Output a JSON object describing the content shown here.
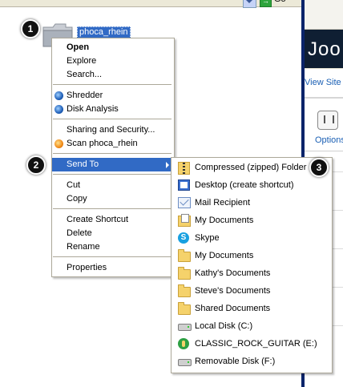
{
  "top_toolbar": {
    "go_label": "Go"
  },
  "right_panel": {
    "logo_text": "Joo",
    "view_site": "View Site",
    "options_label": "Options"
  },
  "folder": {
    "name": "phoca_rhein"
  },
  "callouts": {
    "one": "1",
    "two": "2",
    "three": "3"
  },
  "context_menu": {
    "items": [
      {
        "label": "Open",
        "bold": true
      },
      {
        "label": "Explore"
      },
      {
        "label": "Search..."
      },
      {
        "label": "Shredder",
        "icon": "shredder-icon"
      },
      {
        "label": "Disk Analysis",
        "icon": "disk-analysis-icon"
      },
      {
        "label": "Sharing and Security..."
      },
      {
        "label": "Scan phoca_rhein",
        "icon": "antivirus-scan-icon"
      },
      {
        "label": "Send To",
        "highlighted": true,
        "has_submenu": true
      },
      {
        "label": "Cut"
      },
      {
        "label": "Copy"
      },
      {
        "label": "Create Shortcut"
      },
      {
        "label": "Delete"
      },
      {
        "label": "Rename"
      },
      {
        "label": "Properties"
      }
    ]
  },
  "send_to_menu": {
    "items": [
      {
        "label": "Compressed (zipped) Folder",
        "icon": "zip-folder-icon"
      },
      {
        "label": "Desktop (create shortcut)",
        "icon": "desktop-icon"
      },
      {
        "label": "Mail Recipient",
        "icon": "mail-icon"
      },
      {
        "label": "My Documents",
        "icon": "my-documents-icon"
      },
      {
        "label": "Skype",
        "icon": "skype-icon"
      },
      {
        "label": "My Documents",
        "icon": "folder-icon"
      },
      {
        "label": "Kathy's Documents",
        "icon": "folder-icon"
      },
      {
        "label": "Steve's Documents",
        "icon": "folder-icon"
      },
      {
        "label": "Shared Documents",
        "icon": "folder-icon"
      },
      {
        "label": "Local Disk (C:)",
        "icon": "local-disk-icon"
      },
      {
        "label": "CLASSIC_ROCK_GUITAR (E:)",
        "icon": "removable-drive-icon"
      },
      {
        "label": "Removable Disk (F:)",
        "icon": "removable-disk-icon"
      }
    ]
  }
}
